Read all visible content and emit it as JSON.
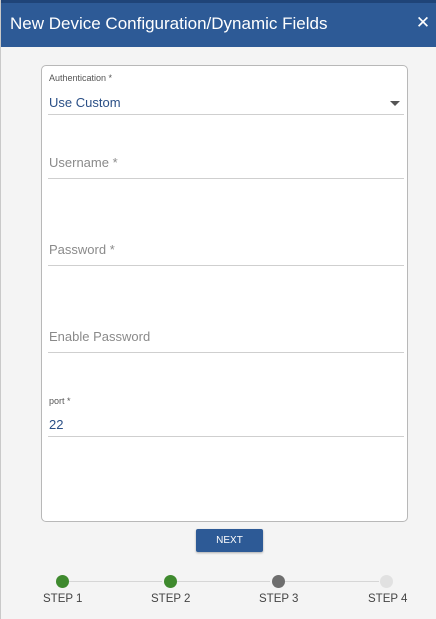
{
  "dialog": {
    "title": "New Device Configuration/Dynamic Fields",
    "close_label": "✕"
  },
  "form": {
    "authentication": {
      "label": "Authentication *",
      "value": "Use Custom",
      "icon": "chevron-down-icon"
    },
    "username": {
      "placeholder": "Username *"
    },
    "password": {
      "placeholder": "Password *"
    },
    "enable_password": {
      "placeholder": "Enable Password"
    },
    "port": {
      "label": "port *",
      "value": "22"
    }
  },
  "actions": {
    "next_label": "NEXT"
  },
  "stepper": {
    "steps": [
      {
        "label": "STEP 1",
        "state": "completed",
        "color": "#3f8a2e"
      },
      {
        "label": "STEP 2",
        "state": "completed",
        "color": "#3f8a2e"
      },
      {
        "label": "STEP 3",
        "state": "current",
        "color": "#6e6e6e"
      },
      {
        "label": "STEP 4",
        "state": "pending",
        "color": "#e1e1e1"
      }
    ]
  },
  "colors": {
    "title_bar": "#2d5a96",
    "accent": "#2d5a96",
    "value_text": "#2a4f86"
  }
}
